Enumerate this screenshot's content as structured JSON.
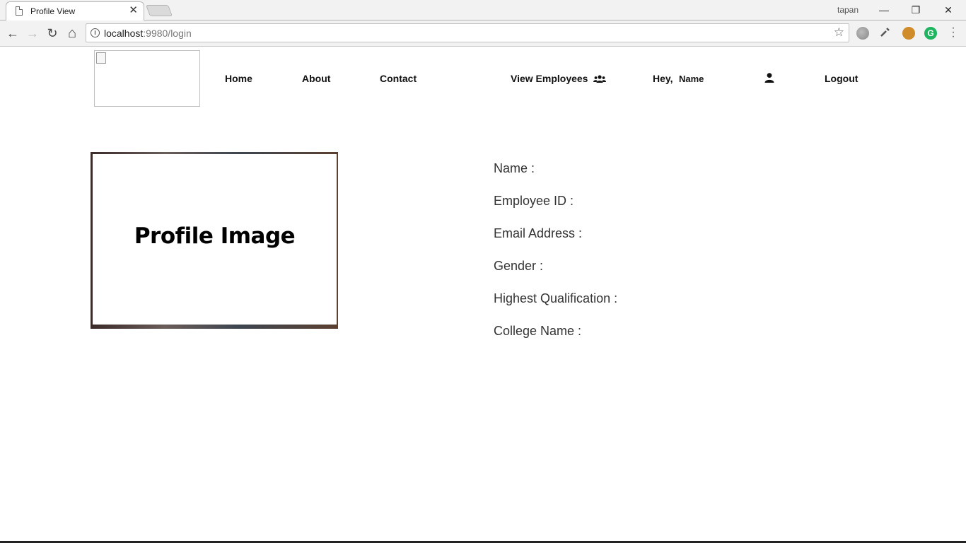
{
  "browser": {
    "tab_title": "Profile View",
    "tab_close": "✕",
    "profile_name": "tapan",
    "window_controls": {
      "minimize": "—",
      "restore": "❐",
      "close": "✕"
    },
    "nav": {
      "back": "←",
      "forward": "→",
      "reload": "↻",
      "home": "⌂"
    },
    "url_host": "localhost",
    "url_path": ":9980/login",
    "bookmark_star": "☆"
  },
  "navbar": {
    "home": "Home",
    "about": "About",
    "contact": "Contact",
    "view_employees": "View Employees",
    "greeting": "Hey,",
    "user_name": "Name",
    "logout": "Logout"
  },
  "profile": {
    "image_label": "Profile Image",
    "fields": [
      "Name :",
      "Employee ID :",
      "Email Address :",
      "Gender :",
      "Highest Qualification :",
      "College Name :"
    ]
  },
  "colors": {
    "extension_green": "#1fb45f",
    "cookie": "#d08b2a"
  }
}
